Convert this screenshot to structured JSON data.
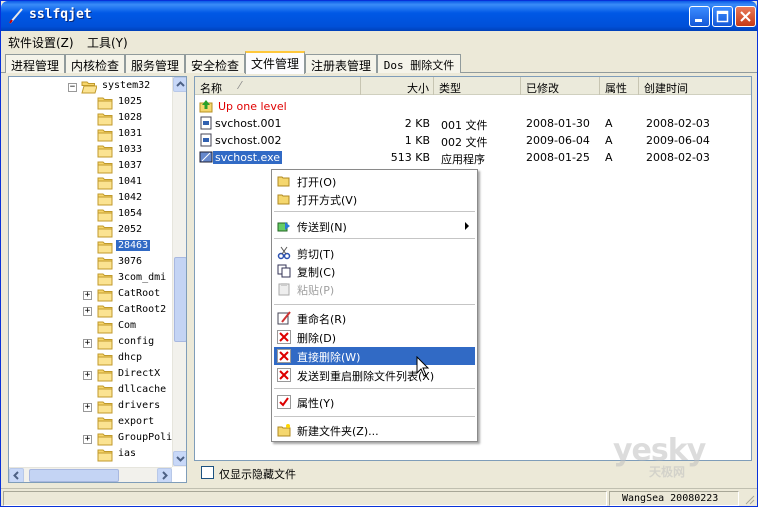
{
  "window": {
    "title": "sslfqjet"
  },
  "menubar": [
    {
      "label": "软件设置(Z)"
    },
    {
      "label": "工具(Y)"
    }
  ],
  "tabs": [
    {
      "label": "进程管理"
    },
    {
      "label": "内核检查"
    },
    {
      "label": "服务管理"
    },
    {
      "label": "安全检查"
    },
    {
      "label": "文件管理",
      "active": true
    },
    {
      "label": "注册表管理"
    },
    {
      "label": "Dos 删除文件"
    }
  ],
  "tree": {
    "items": [
      {
        "label": "system32",
        "expanded": true
      },
      {
        "label": "1025"
      },
      {
        "label": "1028"
      },
      {
        "label": "1031"
      },
      {
        "label": "1033"
      },
      {
        "label": "1037"
      },
      {
        "label": "1041"
      },
      {
        "label": "1042"
      },
      {
        "label": "1054"
      },
      {
        "label": "2052"
      },
      {
        "label": "28463",
        "selected": true
      },
      {
        "label": "3076"
      },
      {
        "label": "3com_dmi"
      },
      {
        "label": "CatRoot",
        "expandable": true
      },
      {
        "label": "CatRoot2",
        "expandable": true
      },
      {
        "label": "Com"
      },
      {
        "label": "config",
        "expandable": true
      },
      {
        "label": "dhcp"
      },
      {
        "label": "DirectX",
        "expandable": true
      },
      {
        "label": "dllcache"
      },
      {
        "label": "drivers",
        "expandable": true
      },
      {
        "label": "export"
      },
      {
        "label": "GroupPoli",
        "expandable": true
      },
      {
        "label": "ias"
      }
    ]
  },
  "list": {
    "columns": [
      "名称",
      "大小",
      "类型",
      "已修改",
      "属性",
      "创建时间"
    ],
    "up_level": "Up one level",
    "rows": [
      {
        "name": "svchost.001",
        "size": "2 KB",
        "type": "001 文件",
        "modified": "2008-01-30",
        "attr": "A",
        "created": "2008-02-03"
      },
      {
        "name": "svchost.002",
        "size": "1 KB",
        "type": "002 文件",
        "modified": "2009-06-04",
        "attr": "A",
        "created": "2009-06-04"
      },
      {
        "name": "svchost.exe",
        "size": "513 KB",
        "type": "应用程序",
        "modified": "2008-01-25",
        "attr": "A",
        "created": "2008-02-03",
        "selected": true
      }
    ]
  },
  "context_menu": {
    "items": [
      {
        "label": "打开(O)",
        "icon": "folder-open-icon"
      },
      {
        "label": "打开方式(V)",
        "icon": "folder-open-icon"
      },
      {
        "label": "传送到(N)",
        "icon": "send-to-icon",
        "submenu": true
      },
      {
        "label": "剪切(T)",
        "icon": "scissors-icon"
      },
      {
        "label": "复制(C)",
        "icon": "copy-icon"
      },
      {
        "label": "粘贴(P)",
        "icon": "paste-icon",
        "disabled": true
      },
      {
        "label": "重命名(R)",
        "icon": "rename-icon"
      },
      {
        "label": "删除(D)",
        "icon": "delete-icon"
      },
      {
        "label": "直接删除(W)",
        "icon": "delete-icon",
        "highlighted": true
      },
      {
        "label": "发送到重启删除文件列表(X)",
        "icon": "delete-icon"
      },
      {
        "label": "属性(Y)",
        "icon": "checkmark-icon"
      },
      {
        "label": "新建文件夹(Z)...",
        "icon": "new-folder-icon"
      }
    ]
  },
  "hidden_checkbox": {
    "label": "仅显示隐藏文件",
    "checked": false
  },
  "status": {
    "text": "WangSea 20080223"
  },
  "watermark": {
    "brand": "yesky",
    "sub": "天极网"
  },
  "colors": {
    "selection": "#316ac5",
    "titlebar": "#0058e6",
    "up_level_text": "#e00000"
  }
}
